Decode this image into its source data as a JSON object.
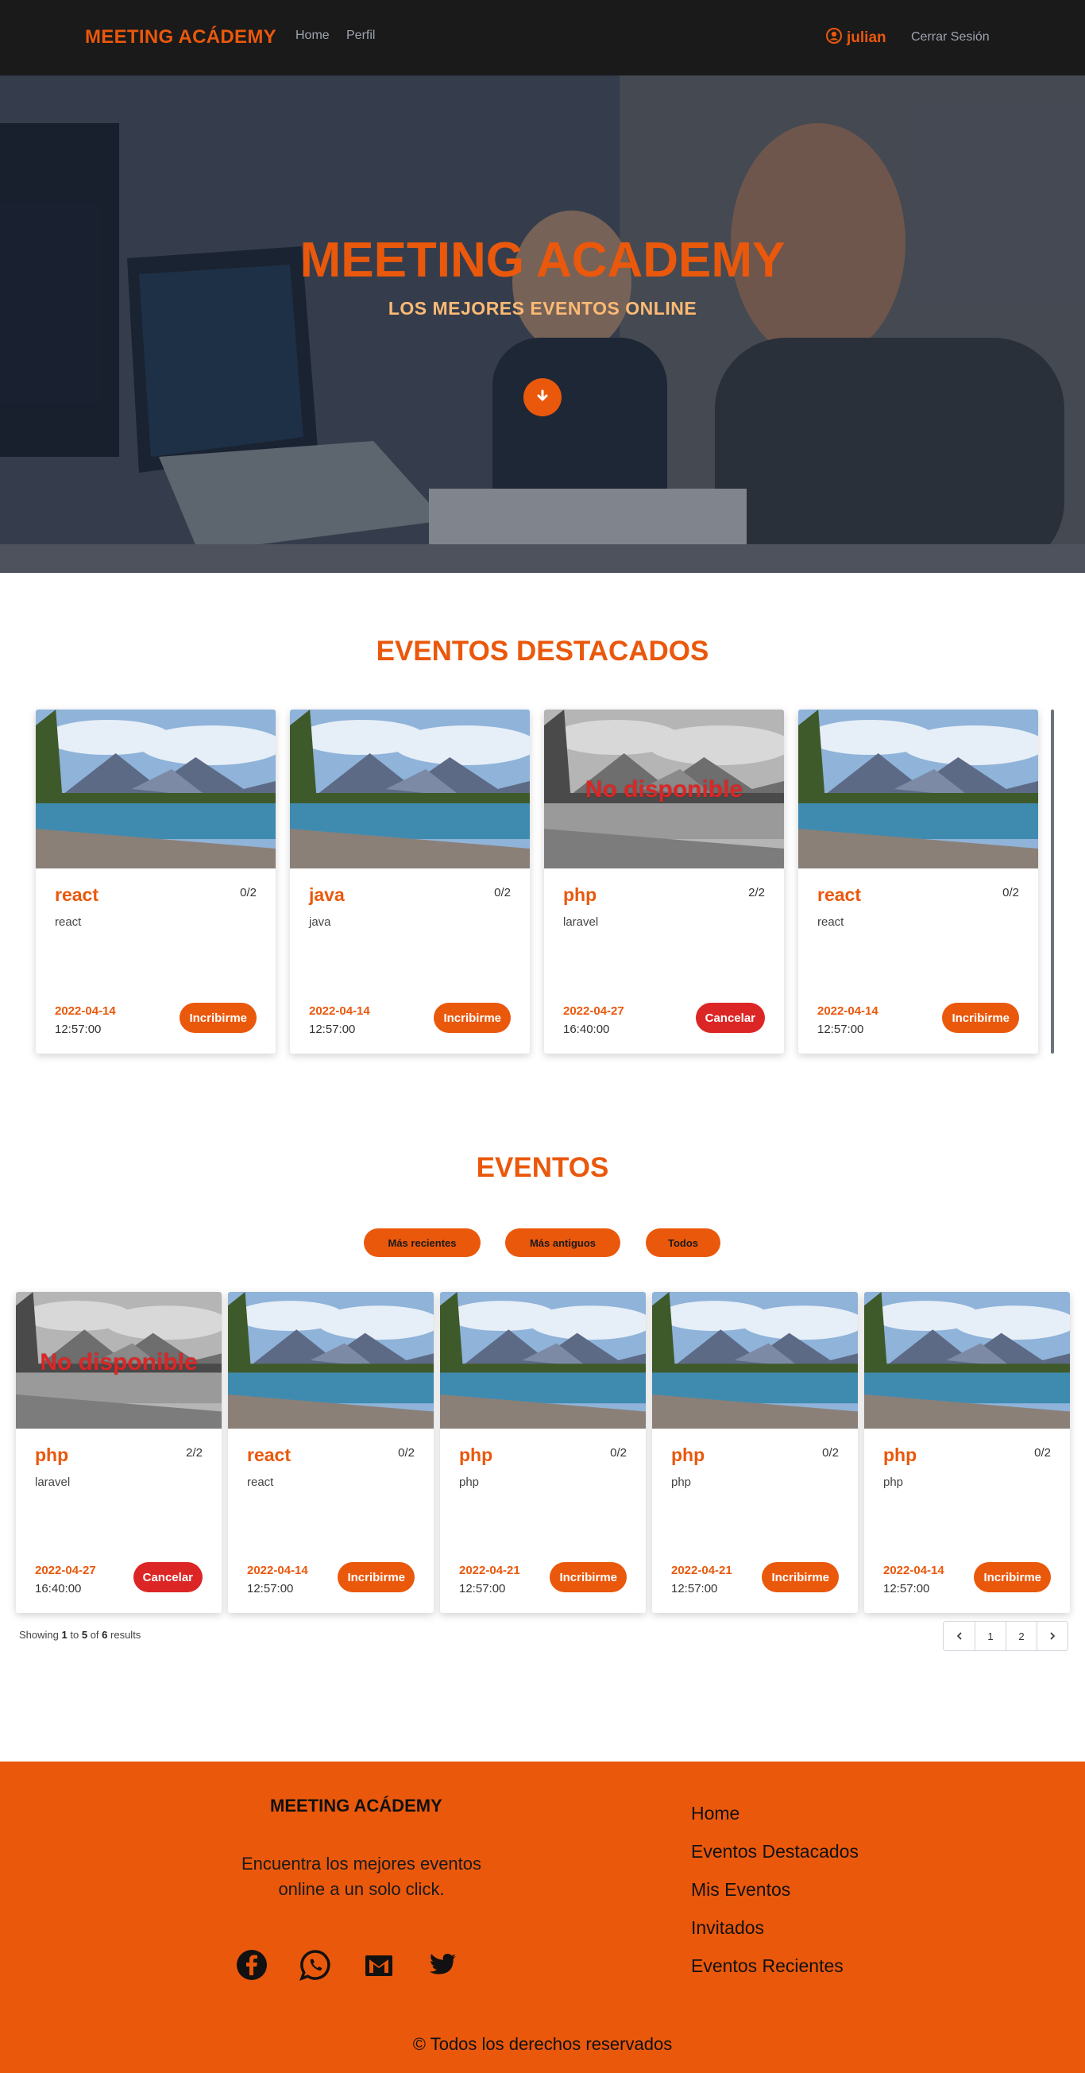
{
  "colors": {
    "accent": "#ea580c",
    "danger": "#dc2626",
    "nav_bg": "#1a1a1a"
  },
  "nav": {
    "brand": "MEETING ACÁDEMY",
    "links": [
      "Home",
      "Perfil"
    ],
    "user": "julian",
    "logout": "Cerrar Sesión"
  },
  "hero": {
    "title": "MEETING ACADEMY",
    "subtitle": "LOS MEJORES EVENTOS ONLINE",
    "scroll_icon": "arrow-down-icon"
  },
  "featured": {
    "title": "EVENTOS DESTACADOS",
    "cards": [
      {
        "title": "react",
        "capacity": "0/2",
        "desc": "react",
        "date": "2022-04-14",
        "time": "12:57:00",
        "button": "Incribirme",
        "unavailable": false
      },
      {
        "title": "java",
        "capacity": "0/2",
        "desc": "java",
        "date": "2022-04-14",
        "time": "12:57:00",
        "button": "Incribirme",
        "unavailable": false
      },
      {
        "title": "php",
        "capacity": "2/2",
        "desc": "laravel",
        "date": "2022-04-27",
        "time": "16:40:00",
        "button": "Cancelar",
        "unavailable": true,
        "unavailable_text": "No disponible"
      },
      {
        "title": "react",
        "capacity": "0/2",
        "desc": "react",
        "date": "2022-04-14",
        "time": "12:57:00",
        "button": "Incribirme",
        "unavailable": false
      }
    ]
  },
  "events": {
    "title": "EVENTOS",
    "filters": [
      "Más recientes",
      "Más antiguos",
      "Todos"
    ],
    "cards": [
      {
        "title": "php",
        "capacity": "2/2",
        "desc": "laravel",
        "date": "2022-04-27",
        "time": "16:40:00",
        "button": "Cancelar",
        "unavailable": true,
        "unavailable_text": "No disponible"
      },
      {
        "title": "react",
        "capacity": "0/2",
        "desc": "react",
        "date": "2022-04-14",
        "time": "12:57:00",
        "button": "Incribirme",
        "unavailable": false
      },
      {
        "title": "php",
        "capacity": "0/2",
        "desc": "php",
        "date": "2022-04-21",
        "time": "12:57:00",
        "button": "Incribirme",
        "unavailable": false
      },
      {
        "title": "php",
        "capacity": "0/2",
        "desc": "php",
        "date": "2022-04-21",
        "time": "12:57:00",
        "button": "Incribirme",
        "unavailable": false
      },
      {
        "title": "php",
        "capacity": "0/2",
        "desc": "php",
        "date": "2022-04-14",
        "time": "12:57:00",
        "button": "Incribirme",
        "unavailable": false
      }
    ],
    "pagination": {
      "showing_prefix": "Showing",
      "from": "1",
      "to_word": "to",
      "to": "5",
      "of_word": "of",
      "total": "6",
      "suffix": "results",
      "pages": [
        "1",
        "2"
      ],
      "prev_icon": "chevron-left-icon",
      "next_icon": "chevron-right-icon"
    }
  },
  "footer": {
    "brand": "MEETING ACÁDEMY",
    "text": "Encuentra los mejores eventos online a un solo click.",
    "social_icons": [
      "facebook-icon",
      "whatsapp-icon",
      "gmail-icon",
      "twitter-icon"
    ],
    "links": [
      "Home",
      "Eventos Destacados",
      "Mis Eventos",
      "Invitados",
      "Eventos Recientes"
    ],
    "copyright": "© Todos los derechos reservados"
  }
}
